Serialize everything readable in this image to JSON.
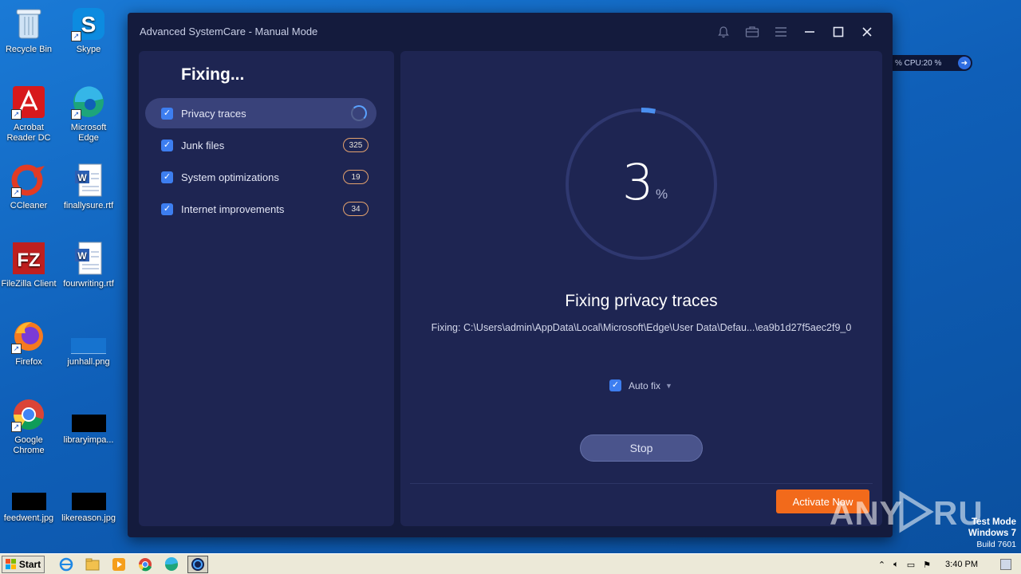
{
  "desktop": {
    "icons": [
      {
        "label": "Recycle Bin"
      },
      {
        "label": "Skype"
      },
      {
        "label": "Acrobat Reader DC"
      },
      {
        "label": "Microsoft Edge"
      },
      {
        "label": "CCleaner"
      },
      {
        "label": "finallysure.rtf"
      },
      {
        "label": "FileZilla Client"
      },
      {
        "label": "fourwriting.rtf"
      },
      {
        "label": "Firefox"
      },
      {
        "label": "junhall.png"
      },
      {
        "label": "Google Chrome"
      },
      {
        "label": "libraryimpa..."
      },
      {
        "label": "feedwent.jpg"
      },
      {
        "label": "likereason.jpg"
      }
    ]
  },
  "window": {
    "title": "Advanced SystemCare - Manual Mode"
  },
  "left_panel": {
    "title": "Fixing...",
    "items": [
      {
        "label": "Privacy traces",
        "count": ""
      },
      {
        "label": "Junk files",
        "count": "325"
      },
      {
        "label": "System optimizations",
        "count": "19"
      },
      {
        "label": "Internet improvements",
        "count": "34"
      }
    ]
  },
  "progress": {
    "value": "3",
    "unit": "%",
    "fraction": 0.03,
    "heading": "Fixing privacy traces",
    "path": "Fixing: C:\\Users\\admin\\AppData\\Local\\Microsoft\\Edge\\User Data\\Defau...\\ea9b1d27f5aec2f9_0"
  },
  "controls": {
    "autofix_label": "Auto fix",
    "stop_label": "Stop",
    "activate_label": "Activate Now"
  },
  "stats_widget": {
    "text": "%  CPU:20 %"
  },
  "watermark": {
    "brand": "ANY RUN",
    "test_mode": "Test Mode",
    "os": "Windows 7",
    "build": "Build 7601"
  },
  "taskbar": {
    "start_label": "Start",
    "clock": "3:40 PM"
  },
  "colors": {
    "accent_blue": "#3d7ef0",
    "activate_orange": "#f26a1b",
    "panel_bg": "#1e2552"
  }
}
